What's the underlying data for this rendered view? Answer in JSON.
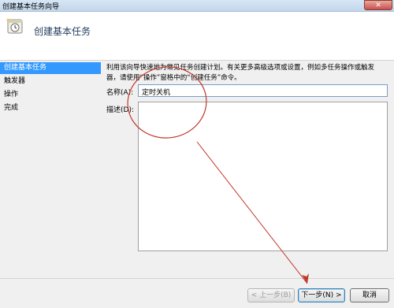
{
  "window": {
    "title": "创建基本任务向导",
    "close_glyph": "✕"
  },
  "header": {
    "title": "创建基本任务",
    "icon": "task-clock-icon"
  },
  "sidebar": {
    "items": [
      {
        "label": "创建基本任务",
        "active": true
      },
      {
        "label": "触发器",
        "active": false
      },
      {
        "label": "操作",
        "active": false
      },
      {
        "label": "完成",
        "active": false
      }
    ]
  },
  "main": {
    "description_line1": "利用该向导快速地为常见任务创建计划。有关更多高级选项或设置，例如多任务操作或触发",
    "description_line2": "器，请使用“操作”窗格中的“创建任务”命令。",
    "name_label": "名称(A):",
    "name_value": "定时关机",
    "desc_label": "描述(D):",
    "desc_value": ""
  },
  "footer": {
    "back_label": "< 上一步(B)",
    "next_label": "下一步(N) >",
    "cancel_label": "取消"
  },
  "colors": {
    "accent": "#3399ff",
    "annotation": "#c0392b"
  }
}
